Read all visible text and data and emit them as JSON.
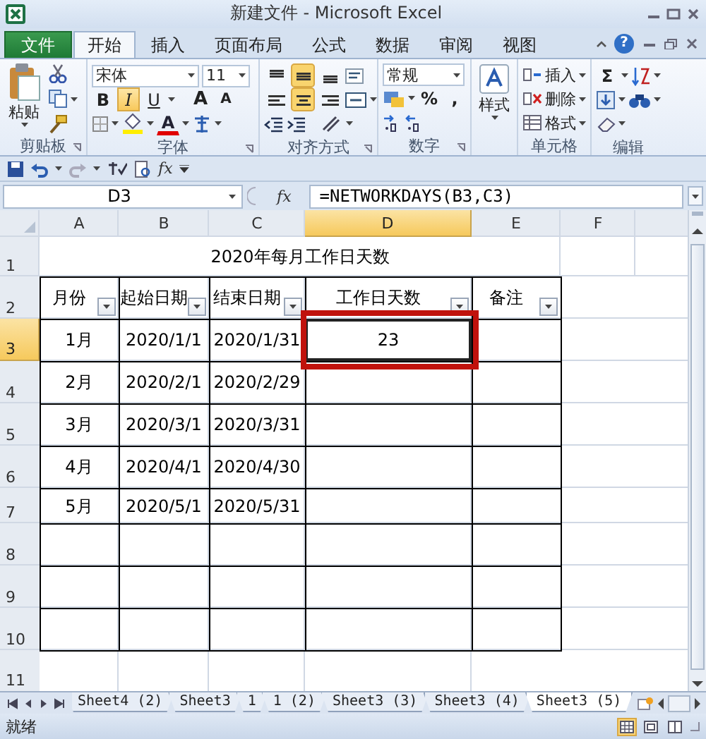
{
  "window": {
    "title": "新建文件 - Microsoft Excel"
  },
  "ribbon_tabs": [
    {
      "label": "文件",
      "kind": "file",
      "selected": false
    },
    {
      "label": "开始",
      "kind": "tab",
      "selected": true
    },
    {
      "label": "插入",
      "kind": "tab",
      "selected": false
    },
    {
      "label": "页面布局",
      "kind": "tab",
      "selected": false
    },
    {
      "label": "公式",
      "kind": "tab",
      "selected": false
    },
    {
      "label": "数据",
      "kind": "tab",
      "selected": false
    },
    {
      "label": "审阅",
      "kind": "tab",
      "selected": false
    },
    {
      "label": "视图",
      "kind": "tab",
      "selected": false
    }
  ],
  "help_label": "?",
  "ribbon_groups": [
    {
      "kind": "clipboard",
      "label": "剪贴板",
      "paste_label": "粘贴"
    },
    {
      "kind": "font",
      "label": "字体",
      "font_name": "宋体",
      "font_size": "11",
      "style_buttons": [
        {
          "label": "B",
          "on": false
        },
        {
          "label": "I",
          "on": true
        },
        {
          "label": "U",
          "on": false
        }
      ],
      "size_buttons": [
        "A",
        "A"
      ],
      "color_label": "A"
    },
    {
      "kind": "alignment",
      "label": "对齐方式",
      "align_buttons": [
        {
          "on": false
        },
        {
          "on": true
        },
        {
          "on": false
        },
        {
          "on": false
        },
        {
          "on": true
        },
        {
          "on": false
        }
      ]
    },
    {
      "kind": "number",
      "label": "数字",
      "number_format": "常规",
      "symbols": [
        "%",
        ","
      ]
    },
    {
      "kind": "styles",
      "label": "样式"
    },
    {
      "kind": "cells",
      "label": "单元格",
      "buttons": [
        "插入",
        "删除",
        "格式"
      ]
    },
    {
      "kind": "editing",
      "label": "编辑",
      "sum_label": "Σ"
    }
  ],
  "quick_access": {
    "formula_label": "fx"
  },
  "formula_bar": {
    "name_box": "D3",
    "fx_label": "fx",
    "formula": "=NETWORKDAYS(B3,C3)"
  },
  "sheet": {
    "columns": [
      {
        "label": "A",
        "selected": false
      },
      {
        "label": "B",
        "selected": false
      },
      {
        "label": "C",
        "selected": false
      },
      {
        "label": "D",
        "selected": true
      },
      {
        "label": "E",
        "selected": false
      },
      {
        "label": "F",
        "selected": false
      }
    ],
    "title_row": {
      "number": "1",
      "selected": false,
      "text": "2020年每月工作日天数"
    },
    "rows": [
      {
        "number": "2",
        "selected": false,
        "kind": "header",
        "cells": [
          "月份",
          "起始日期",
          "结束日期",
          "工作日天数",
          "备注"
        ]
      },
      {
        "number": "3",
        "selected": true,
        "kind": "data",
        "cells": [
          "1月",
          "2020/1/1",
          "2020/1/31",
          {
            "text": "23",
            "highlighted": true
          },
          ""
        ]
      },
      {
        "number": "4",
        "selected": false,
        "kind": "data",
        "cells": [
          "2月",
          "2020/2/1",
          "2020/2/29",
          "",
          ""
        ]
      },
      {
        "number": "5",
        "selected": false,
        "kind": "data",
        "cells": [
          "3月",
          "2020/3/1",
          "2020/3/31",
          "",
          ""
        ]
      },
      {
        "number": "6",
        "selected": false,
        "kind": "data",
        "cells": [
          "4月",
          "2020/4/1",
          "2020/4/30",
          "",
          ""
        ]
      },
      {
        "number": "7",
        "selected": false,
        "kind": "data",
        "cells": [
          "5月",
          "2020/5/1",
          "2020/5/31",
          "",
          ""
        ]
      },
      {
        "number": "8",
        "selected": false,
        "kind": "data",
        "cells": [
          "",
          "",
          "",
          "",
          ""
        ]
      },
      {
        "number": "9",
        "selected": false,
        "kind": "data",
        "cells": [
          "",
          "",
          "",
          "",
          ""
        ]
      },
      {
        "number": "10",
        "selected": false,
        "kind": "data",
        "cells": [
          "",
          "",
          "",
          "",
          ""
        ]
      },
      {
        "number": "11",
        "selected": false,
        "kind": "blank",
        "cells": [
          "",
          "",
          "",
          "",
          ""
        ]
      }
    ]
  },
  "sheet_tabs": [
    {
      "label": "Sheet4 (2)",
      "selected": false
    },
    {
      "label": "Sheet3",
      "selected": false
    },
    {
      "label": "1",
      "selected": false
    },
    {
      "label": "1 (2)",
      "selected": false
    },
    {
      "label": "Sheet3 (3)",
      "selected": false
    },
    {
      "label": "Sheet3 (4)",
      "selected": false
    },
    {
      "label": "Sheet3 (5)",
      "selected": true
    }
  ],
  "status_bar": {
    "text": "就绪",
    "views": [
      {
        "kind": "normal",
        "selected": true
      },
      {
        "kind": "layout",
        "selected": false
      },
      {
        "kind": "break",
        "selected": false
      }
    ]
  }
}
